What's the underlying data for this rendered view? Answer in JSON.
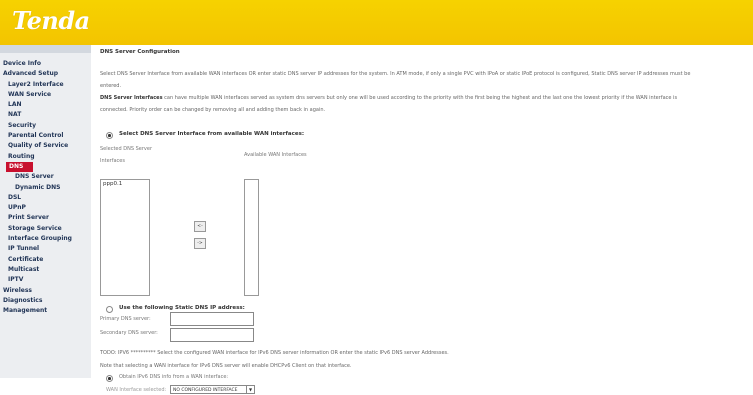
{
  "brand": {
    "logo_text": "Tenda",
    "header_color": "#f4c800",
    "accent_color": "#c8102e"
  },
  "sidebar": {
    "items": [
      {
        "label": "Device Info",
        "level": 0
      },
      {
        "label": "Advanced Setup",
        "level": 0
      },
      {
        "label": "Layer2 Interface",
        "level": 1
      },
      {
        "label": "WAN Service",
        "level": 1
      },
      {
        "label": "LAN",
        "level": 1
      },
      {
        "label": "NAT",
        "level": 1
      },
      {
        "label": "Security",
        "level": 1
      },
      {
        "label": "Parental Control",
        "level": 1
      },
      {
        "label": "Quality of Service",
        "level": 1
      },
      {
        "label": "Routing",
        "level": 1
      },
      {
        "label": "DNS",
        "level": 1,
        "active": true
      },
      {
        "label": "DNS Server",
        "level": 2
      },
      {
        "label": "Dynamic DNS",
        "level": 2
      },
      {
        "label": "DSL",
        "level": 1
      },
      {
        "label": "UPnP",
        "level": 1
      },
      {
        "label": "Print Server",
        "level": 1
      },
      {
        "label": "Storage Service",
        "level": 1
      },
      {
        "label": "Interface Grouping",
        "level": 1
      },
      {
        "label": "IP Tunnel",
        "level": 1
      },
      {
        "label": "Certificate",
        "level": 1
      },
      {
        "label": "Multicast",
        "level": 1
      },
      {
        "label": "IPTV",
        "level": 1
      },
      {
        "label": "Wireless",
        "level": 0
      },
      {
        "label": "Diagnostics",
        "level": 0
      },
      {
        "label": "Management",
        "level": 0
      }
    ]
  },
  "main": {
    "title": "DNS Server Configuration",
    "intro_line1": "Select DNS Server Interface from available WAN interfaces OR enter static DNS server IP addresses for the system. In ATM mode, if only a single PVC with IPoA or static IPoE protocol is configured, Static DNS server IP addresses must be",
    "intro_line2": "entered.",
    "intro_bold": "DNS Server Interfaces",
    "intro_line3": " can have multiple WAN interfaces served as system dns servers but only one will be used according to the priority with the first being the highest and the last one the lowest priority if the WAN interface is",
    "intro_line4": "connected. Priority order can be changed by removing all and adding them back in again.",
    "option1_label": "Select DNS Server Interface from available WAN interfaces:",
    "selected_label_1": "Selected DNS Server",
    "selected_label_2": "Interfaces",
    "available_label": "Available WAN Interfaces",
    "selected_items": [
      "ppp0.1"
    ],
    "move_right": "->",
    "move_left": "<-",
    "option2_label": "Use the following Static DNS IP address:",
    "primary_label": "Primary DNS server:",
    "primary_value": "",
    "secondary_label": "Secondary DNS server:",
    "secondary_value": "",
    "ipv6_line1": "TODO: IPV6 ********** Select the configured WAN interface for IPv6 DNS server information OR enter the static IPv6 DNS server Addresses.",
    "ipv6_line2": "Note that selecting a WAN interface for IPv6 DNS server will enable DHCPv6 Client on that interface.",
    "ipv6_option_label": "Obtain IPv6 DNS info from a WAN interface:",
    "wan_if_label": "WAN Interface selected:",
    "wan_if_value": "NO CONFIGURED INTERFACE"
  }
}
